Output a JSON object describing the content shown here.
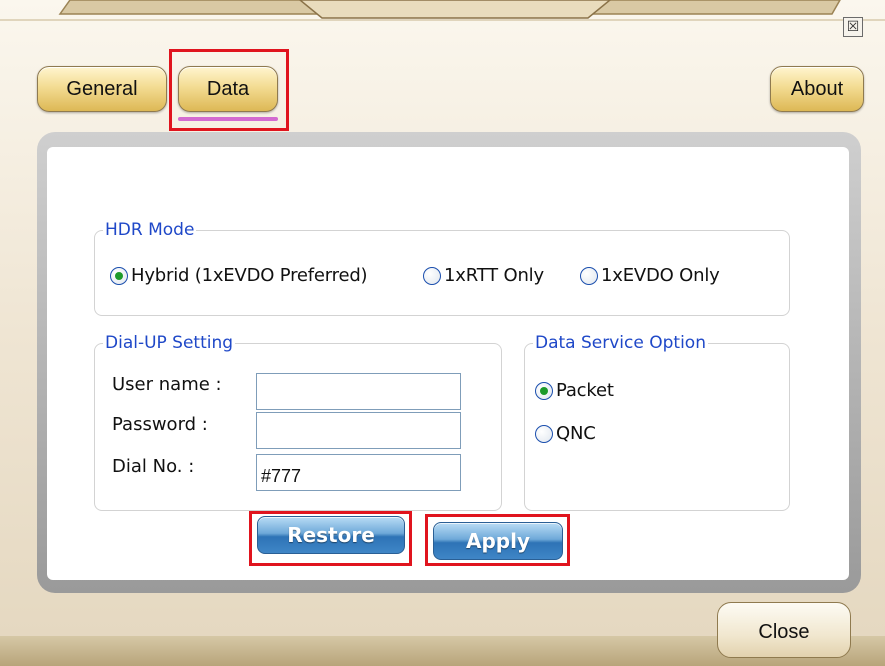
{
  "window": {
    "close_glyph": "☒"
  },
  "tabs": [
    {
      "label": "General"
    },
    {
      "label": "Data"
    },
    {
      "label": "About"
    }
  ],
  "hdr_mode": {
    "legend": "HDR Mode",
    "options": [
      {
        "label": "Hybrid (1xEVDO Preferred)",
        "selected": true
      },
      {
        "label": "1xRTT Only",
        "selected": false
      },
      {
        "label": "1xEVDO Only",
        "selected": false
      }
    ]
  },
  "dialup": {
    "legend": "Dial-UP Setting",
    "username_label": "User name :",
    "username_value": "",
    "password_label": "Password  :",
    "password_value": "",
    "dialno_label": "Dial No.  :",
    "dialno_value": "#777"
  },
  "data_service": {
    "legend": "Data Service Option",
    "options": [
      {
        "label": "Packet",
        "selected": true
      },
      {
        "label": "QNC",
        "selected": false
      }
    ]
  },
  "buttons": {
    "restore": "Restore",
    "apply": "Apply",
    "close": "Close"
  },
  "colors": {
    "legend_text": "#1f48c8",
    "highlight_box": "#e0141e",
    "tab_underline": "#d36bd0",
    "radio_dot": "#1d9a2a"
  }
}
